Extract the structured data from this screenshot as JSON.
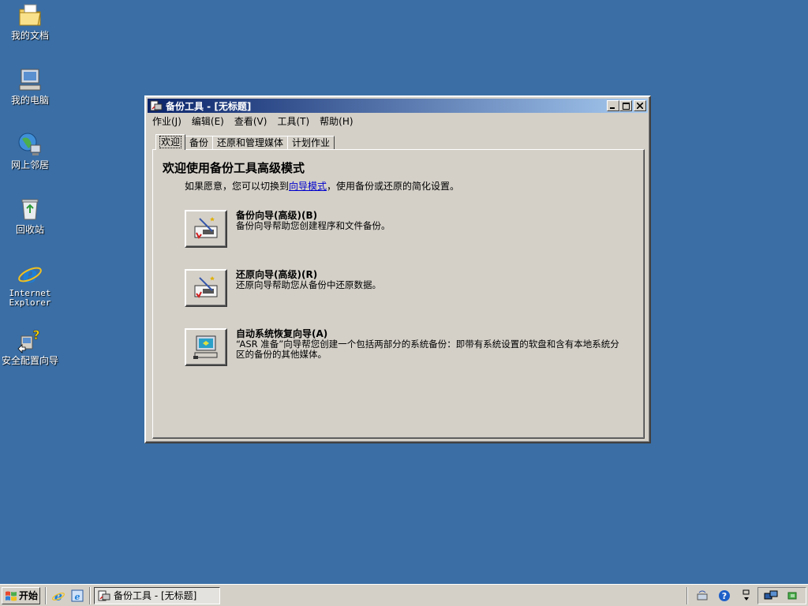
{
  "desktop": {
    "icons": [
      {
        "label": "我的文档",
        "icon": "my-documents-icon"
      },
      {
        "label": "我的电脑",
        "icon": "my-computer-icon"
      },
      {
        "label": "网上邻居",
        "icon": "network-places-icon"
      },
      {
        "label": "回收站",
        "icon": "recycle-bin-icon"
      },
      {
        "label": "Internet\nExplorer",
        "icon": "internet-explorer-icon"
      },
      {
        "label": "安全配置向导",
        "icon": "security-wizard-icon"
      }
    ]
  },
  "window": {
    "title": "备份工具 - [无标题]",
    "menu": [
      "作业(J)",
      "编辑(E)",
      "查看(V)",
      "工具(T)",
      "帮助(H)"
    ],
    "tabs": [
      "欢迎",
      "备份",
      "还原和管理媒体",
      "计划作业"
    ],
    "active_tab": "欢迎",
    "welcome": {
      "heading": "欢迎使用备份工具高级模式",
      "intro_before": "如果愿意，您可以切换到",
      "intro_link": "向导模式",
      "intro_after": "，使用备份或还原的简化设置。"
    },
    "wizards": [
      {
        "title": "备份向导(高级)(B)",
        "desc": "备份向导帮助您创建程序和文件备份。",
        "icon": "backup-wizard-icon"
      },
      {
        "title": "还原向导(高级)(R)",
        "desc": "还原向导帮助您从备份中还原数据。",
        "icon": "restore-wizard-icon"
      },
      {
        "title": "自动系统恢复向导(A)",
        "desc": "“ASR 准备”向导帮您创建一个包括两部分的系统备份：即带有系统设置的软盘和含有本地系统分区的备份的其他媒体。",
        "icon": "asr-wizard-icon"
      }
    ]
  },
  "taskbar": {
    "start_label": "开始",
    "task_label": "备份工具 - [无标题]",
    "quicklaunch": [
      "ie-icon",
      "show-desktop-icon"
    ],
    "tray": [
      "network-icon",
      "help-icon",
      "arrows-icon",
      "network-connection-icon",
      "volume-icon"
    ]
  },
  "colors": {
    "desktop": "#3a6ea5",
    "titlebar_start": "#0a246a",
    "titlebar_end": "#a6caf0",
    "face": "#d4d0c8"
  }
}
